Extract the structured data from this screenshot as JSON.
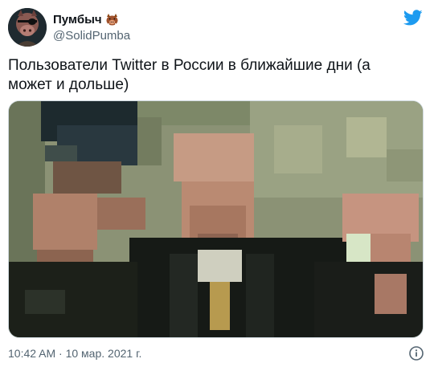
{
  "tweet": {
    "author": {
      "display_name": "Пумбыч",
      "handle": "@SolidPumba",
      "avatar_icon": "boar-with-eyepatch-avatar",
      "badge_icon": "boar-emoji-icon"
    },
    "text": "Пользователи Twitter в России в ближайшие дни (а может и дольше)",
    "media": {
      "kind": "pixelated-photo"
    },
    "timestamp": "10:42 AM · 10 мар. 2021 г.",
    "info_icon": "info-icon"
  },
  "colors": {
    "twitter_blue": "#1d9bf0",
    "text_primary": "#0f1419",
    "text_secondary": "#536471",
    "border": "#cfd9de"
  }
}
